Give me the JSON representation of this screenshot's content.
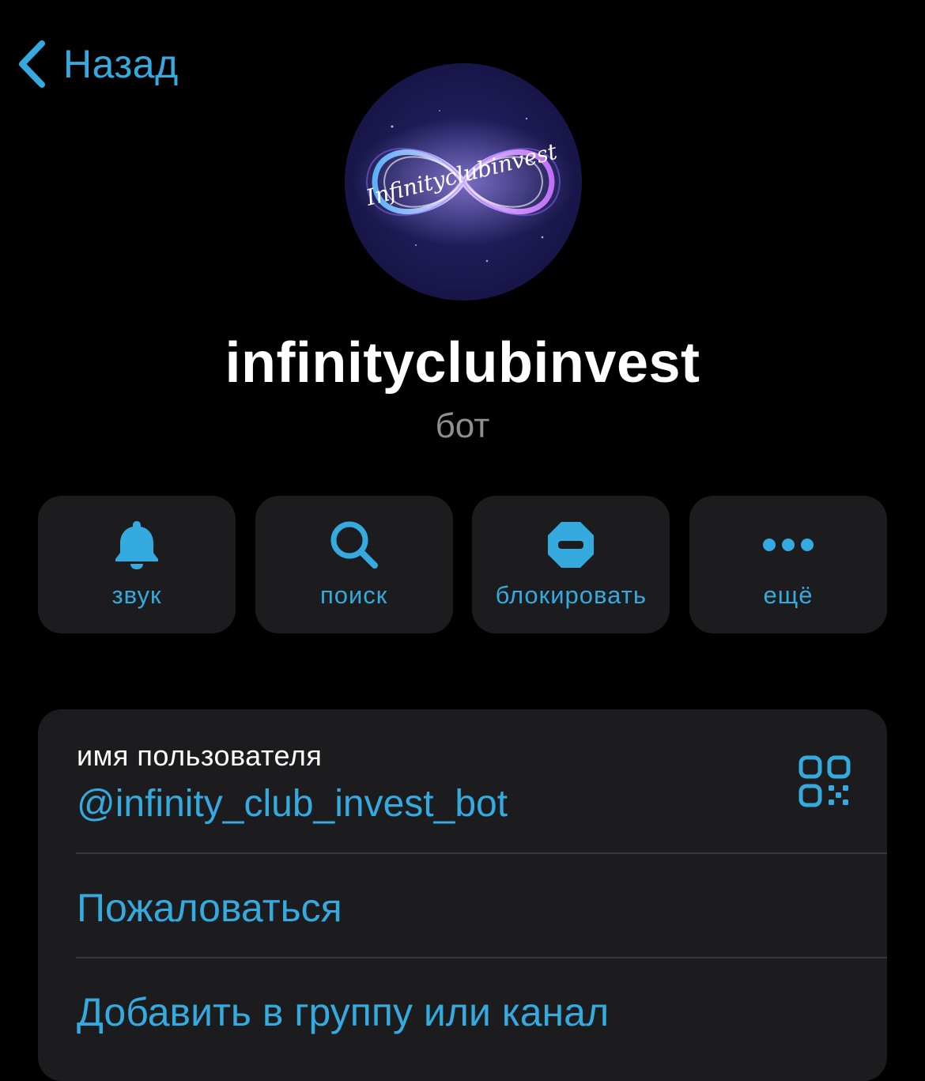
{
  "nav": {
    "back_label": "Назад",
    "accent_color": "#34AADF"
  },
  "profile": {
    "avatar_text": "Infinityclubinvest",
    "name": "infinityclubinvest",
    "status": "бот"
  },
  "actions": [
    {
      "icon": "bell-icon",
      "label": "звук"
    },
    {
      "icon": "search-icon",
      "label": "поиск"
    },
    {
      "icon": "block-icon",
      "label": "блокировать"
    },
    {
      "icon": "more-icon",
      "label": "ещё"
    }
  ],
  "info": {
    "username_caption": "имя пользователя",
    "username_value": "@infinity_club_invest_bot",
    "qr_icon": "qr-code-icon",
    "report_label": "Пожаловаться",
    "add_to_group_label": "Добавить в группу или канал"
  },
  "colors": {
    "background": "#000000",
    "card": "#1C1C1E",
    "accent": "#34AADF",
    "secondary_text": "#8E8E93",
    "divider": "#38383A"
  }
}
